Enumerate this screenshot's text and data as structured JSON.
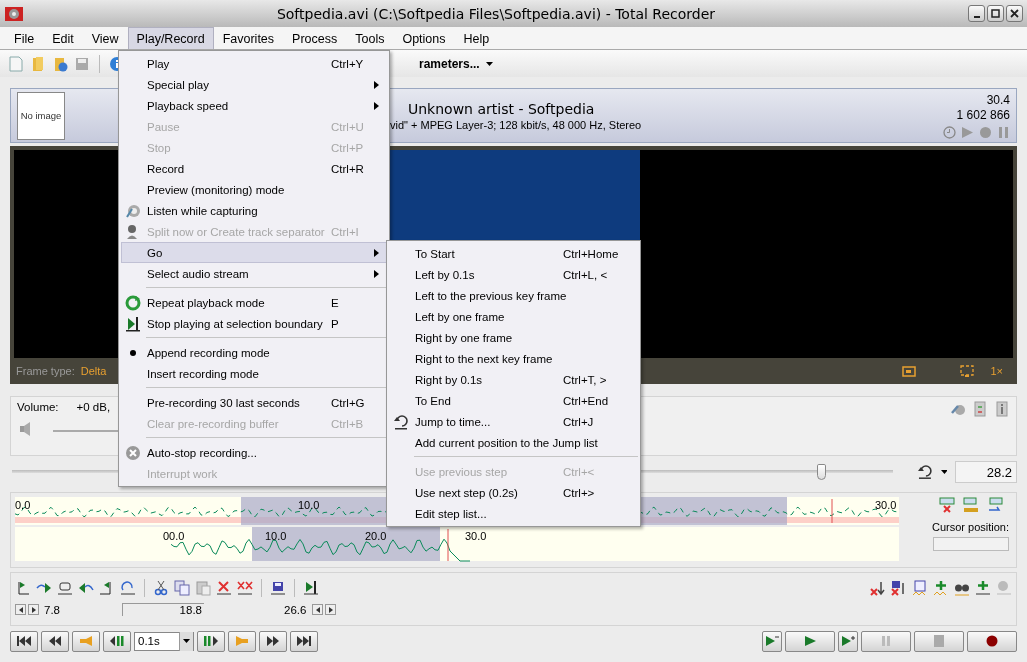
{
  "window": {
    "title": "Softpedia.avi (C:\\Softpedia Files\\Softpedia.avi) - Total Recorder"
  },
  "menu_bar": [
    {
      "label": "File",
      "selected": false
    },
    {
      "label": "Edit",
      "selected": false
    },
    {
      "label": "View",
      "selected": false
    },
    {
      "label": "Play/Record",
      "selected": true
    },
    {
      "label": "Favorites",
      "selected": false
    },
    {
      "label": "Process",
      "selected": false
    },
    {
      "label": "Tools",
      "selected": false
    },
    {
      "label": "Options",
      "selected": false
    },
    {
      "label": "Help",
      "selected": false
    }
  ],
  "toolbar": {
    "parameters_label": "rameters..."
  },
  "info": {
    "thumbnail": "No image",
    "artist_title": "Unknown artist - Softpedia",
    "format": "vid\" + MPEG Layer-3; 128 kbit/s, 48 000 Hz, Stereo",
    "duration": "30.4",
    "size": "1 602 866"
  },
  "video": {
    "frame_type_label": "Frame type:",
    "frame_type": "Delta",
    "zoom": "1×"
  },
  "volume": {
    "label": "Volume:",
    "value": "+0 dB,"
  },
  "position": {
    "level": 0.92,
    "value": "28.2"
  },
  "timeline": {
    "top_labels": [
      "0.0",
      "10.0",
      "30.0"
    ],
    "bottom_labels": [
      "00.0",
      "10.0",
      "20.0",
      "30.0"
    ]
  },
  "cursor_position": {
    "label": "Cursor position:"
  },
  "selection": {
    "start": "7.8",
    "length": "18.8",
    "end": "26.6"
  },
  "step": {
    "value": "0.1s"
  },
  "play_menu": [
    {
      "kind": "item",
      "label": "Play",
      "shortcut": "Ctrl+Y",
      "disabled": false,
      "submenu": false,
      "checked": false,
      "selected": false
    },
    {
      "kind": "item",
      "label": "Special play",
      "disabled": false,
      "submenu": true,
      "checked": false,
      "selected": false
    },
    {
      "kind": "item",
      "label": "Playback speed",
      "disabled": false,
      "submenu": true,
      "checked": false,
      "selected": false
    },
    {
      "kind": "item",
      "label": "Pause",
      "shortcut": "Ctrl+U",
      "disabled": true,
      "submenu": false,
      "checked": false,
      "selected": false
    },
    {
      "kind": "item",
      "label": "Stop",
      "shortcut": "Ctrl+P",
      "disabled": true,
      "submenu": false,
      "checked": false,
      "selected": false
    },
    {
      "kind": "item",
      "label": "Record",
      "shortcut": "Ctrl+R",
      "disabled": false,
      "submenu": false,
      "checked": false,
      "selected": false
    },
    {
      "kind": "item",
      "label": "Preview (monitoring) mode",
      "disabled": false,
      "submenu": false,
      "checked": false,
      "selected": false
    },
    {
      "kind": "item",
      "label": "Listen while capturing",
      "disabled": false,
      "submenu": false,
      "checked": false,
      "selected": false
    },
    {
      "kind": "item",
      "label": "Split now or Create track separator",
      "shortcut": "Ctrl+I",
      "disabled": true,
      "submenu": false,
      "checked": false,
      "selected": false
    },
    {
      "kind": "item",
      "label": "Go",
      "disabled": false,
      "submenu": true,
      "checked": false,
      "selected": true
    },
    {
      "kind": "item",
      "label": "Select audio stream",
      "disabled": false,
      "submenu": true,
      "checked": false,
      "selected": false
    },
    {
      "kind": "separator"
    },
    {
      "kind": "item",
      "label": "Repeat playback mode",
      "shortcut": "E",
      "disabled": false,
      "submenu": false,
      "checked": false,
      "selected": false
    },
    {
      "kind": "item",
      "label": "Stop playing at selection boundary",
      "shortcut": "P",
      "disabled": false,
      "submenu": false,
      "checked": false,
      "selected": false
    },
    {
      "kind": "separator"
    },
    {
      "kind": "item",
      "label": "Append recording mode",
      "disabled": false,
      "submenu": false,
      "checked": true,
      "selected": false
    },
    {
      "kind": "item",
      "label": "Insert recording mode",
      "disabled": false,
      "submenu": false,
      "checked": false,
      "selected": false
    },
    {
      "kind": "separator"
    },
    {
      "kind": "item",
      "label": "Pre-recording 30 last seconds",
      "shortcut": "Ctrl+G",
      "disabled": false,
      "submenu": false,
      "checked": false,
      "selected": false
    },
    {
      "kind": "item",
      "label": "Clear pre-recording buffer",
      "shortcut": "Ctrl+B",
      "disabled": true,
      "submenu": false,
      "checked": false,
      "selected": false
    },
    {
      "kind": "separator"
    },
    {
      "kind": "item",
      "label": "Auto-stop recording...",
      "disabled": false,
      "submenu": false,
      "checked": false,
      "selected": false
    },
    {
      "kind": "item",
      "label": "Interrupt work",
      "disabled": true,
      "submenu": false,
      "checked": false,
      "selected": false
    }
  ],
  "go_menu": [
    {
      "kind": "item",
      "label": "To Start",
      "shortcut": "Ctrl+Home",
      "disabled": false
    },
    {
      "kind": "item",
      "label": "Left by 0.1s",
      "shortcut": "Ctrl+L, <",
      "disabled": false
    },
    {
      "kind": "item",
      "label": "Left to the previous key frame",
      "disabled": false
    },
    {
      "kind": "item",
      "label": "Left by one frame",
      "disabled": false
    },
    {
      "kind": "item",
      "label": "Right by one frame",
      "disabled": false
    },
    {
      "kind": "item",
      "label": "Right to the next key frame",
      "disabled": false
    },
    {
      "kind": "item",
      "label": "Right by 0.1s",
      "shortcut": "Ctrl+T, >",
      "disabled": false
    },
    {
      "kind": "item",
      "label": "To End",
      "shortcut": "Ctrl+End",
      "disabled": false
    },
    {
      "kind": "item",
      "label": "Jump to time...",
      "shortcut": "Ctrl+J",
      "disabled": false
    },
    {
      "kind": "item",
      "label": "Add current position to the Jump list",
      "disabled": false
    },
    {
      "kind": "separator"
    },
    {
      "kind": "item",
      "label": "Use previous step",
      "shortcut": "Ctrl+<",
      "disabled": true
    },
    {
      "kind": "item",
      "label": "Use next step (0.2s)",
      "shortcut": "Ctrl+>",
      "disabled": false
    },
    {
      "kind": "item",
      "label": "Edit step list...",
      "disabled": false
    }
  ]
}
